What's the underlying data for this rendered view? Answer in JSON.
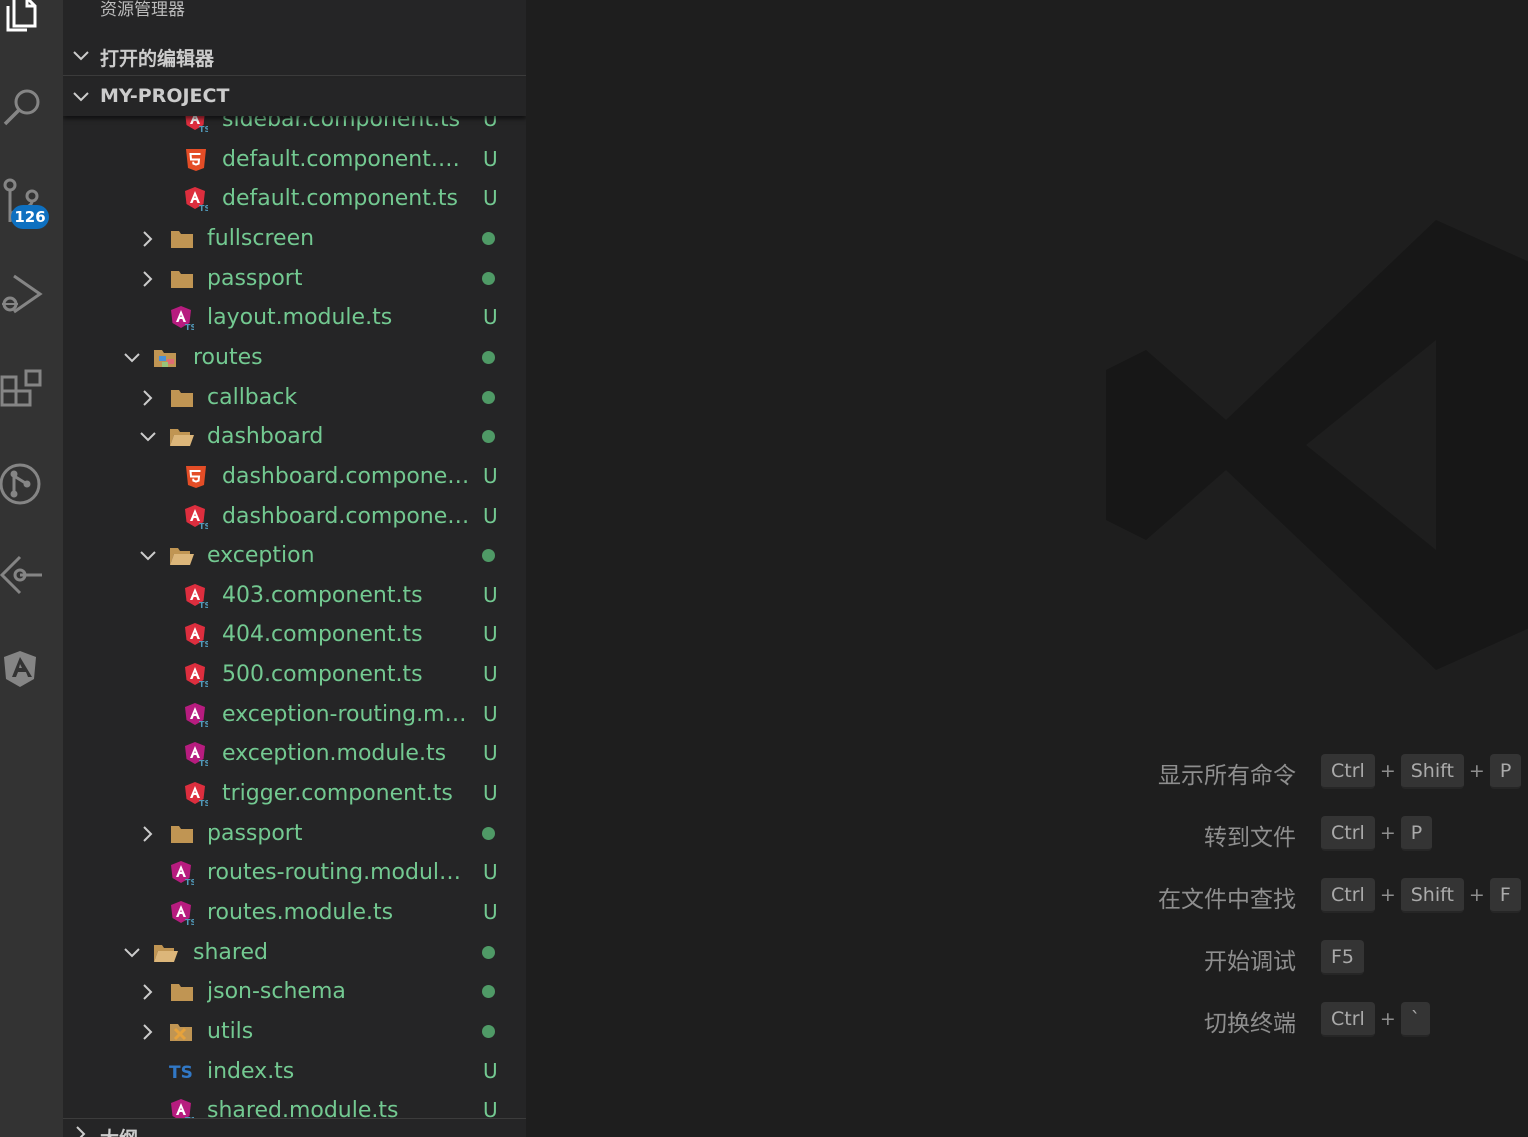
{
  "activity_bar": {
    "source_control_badge": "126",
    "icons": [
      "explorer-icon",
      "search-icon",
      "source-control-icon",
      "run-debug-icon",
      "extensions-icon",
      "git-graph-icon",
      "gitlens-icon",
      "angular-icon"
    ]
  },
  "sidebar": {
    "title": "资源管理器",
    "open_editors_label": "打开的编辑器",
    "project_label": "MY-PROJECT",
    "outline_label": "大纲",
    "tree": [
      {
        "depth": 3,
        "kind": "file",
        "icon": "angular-component-icon",
        "name": "sidebar.component.ts",
        "status": "U"
      },
      {
        "depth": 3,
        "kind": "file",
        "icon": "html5-icon",
        "name": "default.component.html",
        "status": "U"
      },
      {
        "depth": 3,
        "kind": "file",
        "icon": "angular-component-icon",
        "name": "default.component.ts",
        "status": "U"
      },
      {
        "depth": 2,
        "kind": "folder",
        "expanded": false,
        "icon": "folder-icon",
        "name": "fullscreen",
        "status": "dot"
      },
      {
        "depth": 2,
        "kind": "folder",
        "expanded": false,
        "icon": "folder-icon",
        "name": "passport",
        "status": "dot"
      },
      {
        "depth": 2,
        "kind": "file",
        "icon": "angular-module-icon",
        "name": "layout.module.ts",
        "status": "U"
      },
      {
        "depth": 1,
        "kind": "folder",
        "expanded": true,
        "icon": "routes-folder-icon",
        "name": "routes",
        "status": "dot"
      },
      {
        "depth": 2,
        "kind": "folder",
        "expanded": false,
        "icon": "folder-icon",
        "name": "callback",
        "status": "dot"
      },
      {
        "depth": 2,
        "kind": "folder",
        "expanded": true,
        "icon": "folder-open-icon",
        "name": "dashboard",
        "status": "dot"
      },
      {
        "depth": 3,
        "kind": "file",
        "icon": "html5-icon",
        "name": "dashboard.component...",
        "status": "U"
      },
      {
        "depth": 3,
        "kind": "file",
        "icon": "angular-component-icon",
        "name": "dashboard.component...",
        "status": "U"
      },
      {
        "depth": 2,
        "kind": "folder",
        "expanded": true,
        "icon": "folder-open-icon",
        "name": "exception",
        "status": "dot"
      },
      {
        "depth": 3,
        "kind": "file",
        "icon": "angular-component-icon",
        "name": "403.component.ts",
        "status": "U"
      },
      {
        "depth": 3,
        "kind": "file",
        "icon": "angular-component-icon",
        "name": "404.component.ts",
        "status": "U"
      },
      {
        "depth": 3,
        "kind": "file",
        "icon": "angular-component-icon",
        "name": "500.component.ts",
        "status": "U"
      },
      {
        "depth": 3,
        "kind": "file",
        "icon": "angular-module-icon",
        "name": "exception-routing.mo...",
        "status": "U"
      },
      {
        "depth": 3,
        "kind": "file",
        "icon": "angular-module-icon",
        "name": "exception.module.ts",
        "status": "U"
      },
      {
        "depth": 3,
        "kind": "file",
        "icon": "angular-component-icon",
        "name": "trigger.component.ts",
        "status": "U"
      },
      {
        "depth": 2,
        "kind": "folder",
        "expanded": false,
        "icon": "folder-icon",
        "name": "passport",
        "status": "dot"
      },
      {
        "depth": 2,
        "kind": "file",
        "icon": "angular-module-icon",
        "name": "routes-routing.module.ts",
        "status": "U"
      },
      {
        "depth": 2,
        "kind": "file",
        "icon": "angular-module-icon",
        "name": "routes.module.ts",
        "status": "U"
      },
      {
        "depth": 1,
        "kind": "folder",
        "expanded": true,
        "icon": "folder-open-icon",
        "name": "shared",
        "status": "dot"
      },
      {
        "depth": 2,
        "kind": "folder",
        "expanded": false,
        "icon": "folder-icon",
        "name": "json-schema",
        "status": "dot"
      },
      {
        "depth": 2,
        "kind": "folder",
        "expanded": false,
        "icon": "utils-folder-icon",
        "name": "utils",
        "status": "dot"
      },
      {
        "depth": 2,
        "kind": "file",
        "icon": "typescript-icon",
        "name": "index.ts",
        "status": "U"
      },
      {
        "depth": 2,
        "kind": "file",
        "icon": "angular-module-icon",
        "name": "shared.module.ts",
        "status": "U"
      }
    ]
  },
  "editor": {
    "shortcuts": [
      {
        "label": "显示所有命令",
        "keys": [
          "Ctrl",
          "Shift",
          "P"
        ]
      },
      {
        "label": "转到文件",
        "keys": [
          "Ctrl",
          "P"
        ]
      },
      {
        "label": "在文件中查找",
        "keys": [
          "Ctrl",
          "Shift",
          "F"
        ]
      },
      {
        "label": "开始调试",
        "keys": [
          "F5"
        ]
      },
      {
        "label": "切换终端",
        "keys": [
          "Ctrl",
          "`"
        ]
      }
    ]
  },
  "colors": {
    "untracked_text": "#73c991",
    "badge": "#0e70c0",
    "activity_bar": "#333333",
    "sidebar": "#252526",
    "editor": "#1e1e1e"
  }
}
